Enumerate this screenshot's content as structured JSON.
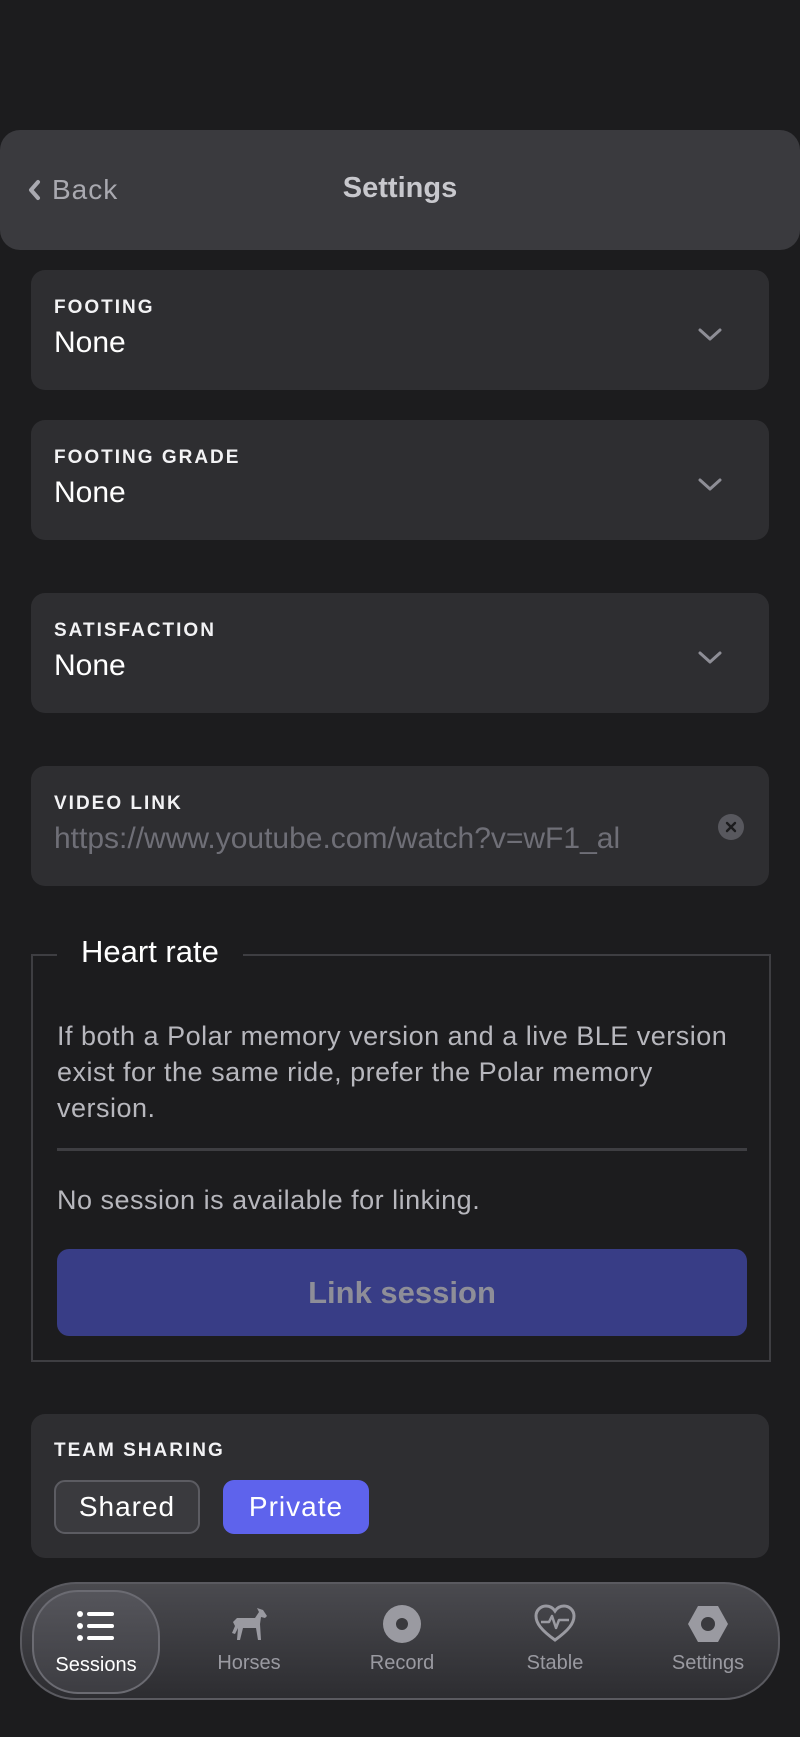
{
  "header": {
    "back_label": "Back",
    "title": "Settings"
  },
  "fields": {
    "footing": {
      "label": "FOOTING",
      "value": "None"
    },
    "footing_grade": {
      "label": "FOOTING GRADE",
      "value": "None"
    },
    "satisfaction": {
      "label": "SATISFACTION",
      "value": "None"
    },
    "video_link": {
      "label": "VIDEO LINK",
      "value": "https://www.youtube.com/watch?v=wF1_al"
    }
  },
  "heart_rate": {
    "legend": "Heart rate",
    "description": "If both a Polar memory version and a live BLE version exist for the same ride, prefer the Polar memory version.",
    "status": "No session is available for linking.",
    "link_button": "Link session"
  },
  "team_sharing": {
    "label": "TEAM SHARING",
    "options": [
      "Shared",
      "Private"
    ],
    "selected": "Private"
  },
  "tabbar": {
    "tabs": [
      {
        "label": "Sessions",
        "icon": "list-icon",
        "active": true
      },
      {
        "label": "Horses",
        "icon": "horse-icon",
        "active": false
      },
      {
        "label": "Record",
        "icon": "record-icon",
        "active": false
      },
      {
        "label": "Stable",
        "icon": "heart-pulse-icon",
        "active": false
      },
      {
        "label": "Settings",
        "icon": "hexagon-gear-icon",
        "active": false
      }
    ]
  },
  "colors": {
    "accent": "#5e63ec",
    "background": "#1c1c1e",
    "card": "#2e2e31"
  }
}
